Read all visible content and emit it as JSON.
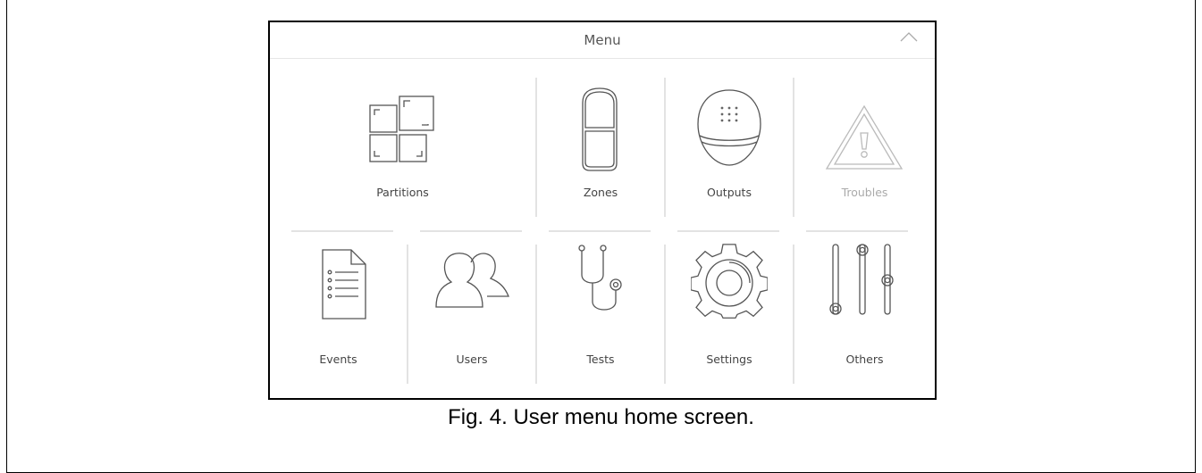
{
  "menu": {
    "title": "Menu",
    "collapse_icon": "chevron-up-icon"
  },
  "tiles": [
    {
      "label": "Partitions",
      "icon": "partitions-icon",
      "enabled": true
    },
    {
      "label": "Zones",
      "icon": "zones-icon",
      "enabled": true
    },
    {
      "label": "Outputs",
      "icon": "outputs-icon",
      "enabled": true
    },
    {
      "label": "Troubles",
      "icon": "troubles-icon",
      "enabled": false
    },
    {
      "label": "Events",
      "icon": "events-icon",
      "enabled": true
    },
    {
      "label": "Users",
      "icon": "users-icon",
      "enabled": true
    },
    {
      "label": "Tests",
      "icon": "tests-icon",
      "enabled": true
    },
    {
      "label": "Settings",
      "icon": "settings-icon",
      "enabled": true
    },
    {
      "label": "Others",
      "icon": "others-icon",
      "enabled": true
    }
  ],
  "caption": "Fig. 4. User menu home screen.",
  "colors": {
    "icon_stroke": "#555555",
    "disabled_stroke": "#bbbbbb",
    "divider": "#e3e3e3"
  }
}
